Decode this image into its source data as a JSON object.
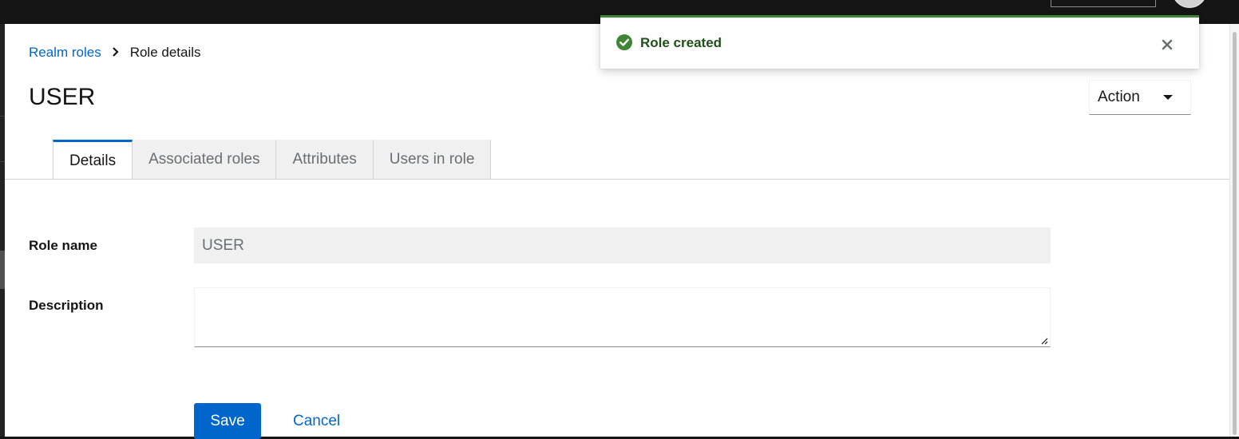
{
  "breadcrumb": {
    "parent": "Realm roles",
    "current": "Role details"
  },
  "page": {
    "title": "USER"
  },
  "action_menu": {
    "label": "Action"
  },
  "tabs": [
    {
      "label": "Details",
      "active": true
    },
    {
      "label": "Associated roles",
      "active": false
    },
    {
      "label": "Attributes",
      "active": false
    },
    {
      "label": "Users in role",
      "active": false
    }
  ],
  "form": {
    "role_name_label": "Role name",
    "role_name_value": "USER",
    "description_label": "Description",
    "description_value": ""
  },
  "buttons": {
    "save": "Save",
    "cancel": "Cancel"
  },
  "toast": {
    "message": "Role created",
    "variant": "success",
    "color": "#3e8635"
  },
  "colors": {
    "primary": "#0066cc",
    "success": "#3e8635",
    "masthead": "#151515"
  }
}
